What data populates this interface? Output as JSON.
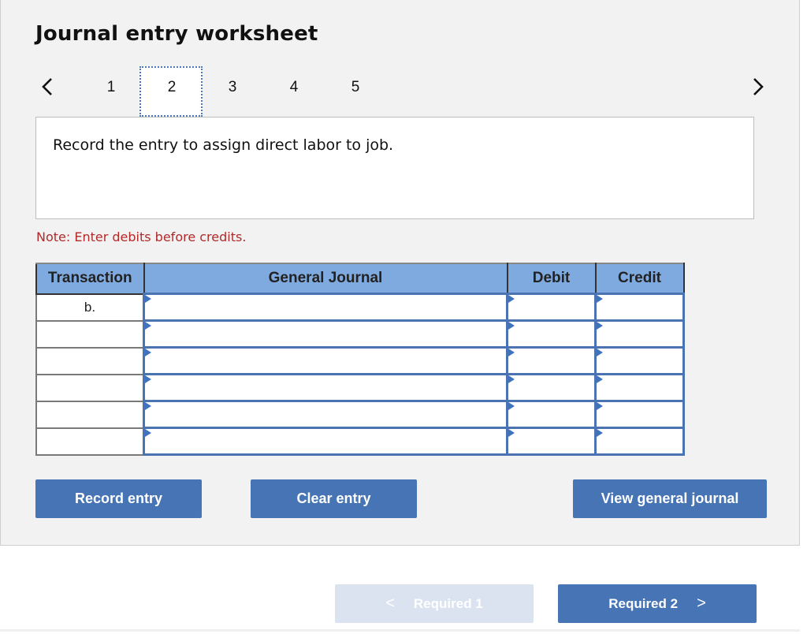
{
  "title": "Journal entry worksheet",
  "steps": {
    "prev_icon": "‹",
    "next_icon": "›",
    "items": [
      "1",
      "2",
      "3",
      "4",
      "5"
    ],
    "active": "2"
  },
  "prompt": "Record the entry to assign direct labor to job.",
  "note": "Note: Enter debits before credits.",
  "table": {
    "headers": [
      "Transaction",
      "General Journal",
      "Debit",
      "Credit"
    ],
    "rows": [
      {
        "transaction": "b.",
        "account": "",
        "debit": "",
        "credit": ""
      },
      {
        "transaction": "",
        "account": "",
        "debit": "",
        "credit": ""
      },
      {
        "transaction": "",
        "account": "",
        "debit": "",
        "credit": ""
      },
      {
        "transaction": "",
        "account": "",
        "debit": "",
        "credit": ""
      },
      {
        "transaction": "",
        "account": "",
        "debit": "",
        "credit": ""
      },
      {
        "transaction": "",
        "account": "",
        "debit": "",
        "credit": ""
      }
    ]
  },
  "buttons": {
    "record": "Record entry",
    "clear": "Clear entry",
    "view": "View general journal"
  },
  "footer": {
    "prev_label": "Required 1",
    "next_label": "Required 2",
    "prev_icon": "<",
    "next_icon": ">"
  },
  "colors": {
    "accent": "#4674b5",
    "header_bg": "#7faadf",
    "note": "#b02a2a",
    "disabled_bg": "#dae3ef"
  }
}
